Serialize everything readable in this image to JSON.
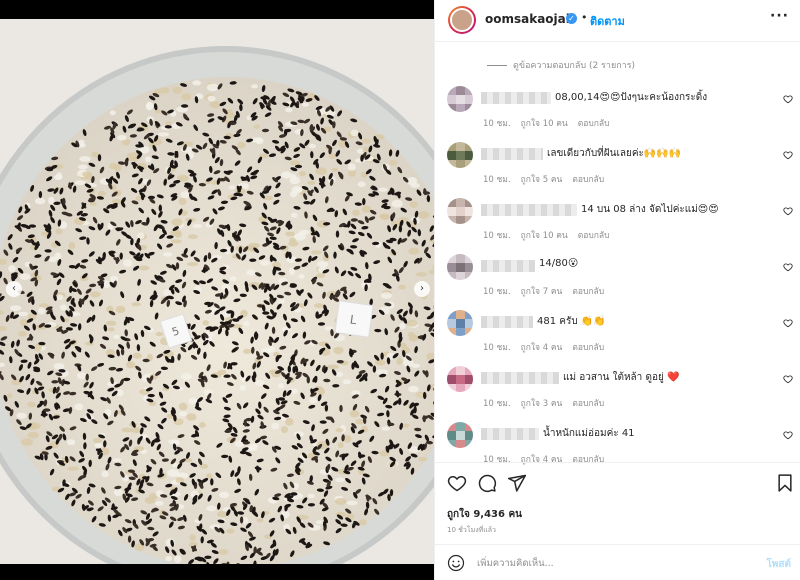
{
  "post": {
    "username": "oomsakaojai",
    "follow_label": "ติดตาม",
    "dot": "•",
    "verified_glyph": "✓",
    "more_glyph": "···"
  },
  "replies_toggle": "ดูข้อความตอบกลับ (2 รายการ)",
  "comments": [
    {
      "text": "08,00,14😍😍ปังๆนะคะน้องกระดิ้ง",
      "time": "10 ชม.",
      "likes": "ถูกใจ 10 คน",
      "reply": "ตอบกลับ"
    },
    {
      "text": "เลขเดียวกับที่ฝันเลยค่ะ🙌🙌🙌",
      "time": "10 ชม.",
      "likes": "ถูกใจ 5 คน",
      "reply": "ตอบกลับ"
    },
    {
      "text": "14 บน 08 ล่าง จัดไปค่ะแม่😍😍",
      "time": "10 ชม.",
      "likes": "ถูกใจ 10 คน",
      "reply": "ตอบกลับ"
    },
    {
      "text": "14/80😮",
      "time": "10 ชม.",
      "likes": "ถูกใจ 7 คน",
      "reply": "ตอบกลับ"
    },
    {
      "text": "481 ครับ 👏👏",
      "time": "10 ชม.",
      "likes": "ถูกใจ 4 คน",
      "reply": "ตอบกลับ"
    },
    {
      "text": "แม่ อวสาน ใต้หล้า ดูอยู่ ❤️",
      "time": "10 ชม.",
      "likes": "ถูกใจ 3 คน",
      "reply": "ตอบกลับ"
    },
    {
      "text": "น้ำหนักแม่อ่อมค่ะ 41",
      "time": "10 ชม.",
      "likes": "ถูกใจ 4 คน",
      "reply": "ตอบกลับ"
    }
  ],
  "likes_total": "ถูกใจ 9,436 คน",
  "posted_ago": "10 ชั่วโมงที่แล้ว",
  "add_comment": {
    "placeholder": "เพิ่มความคิดเห็น...",
    "post_label": "โพสต์"
  },
  "nav": {
    "left_glyph": "‹",
    "right_glyph": "›"
  },
  "colors": {
    "accent": "#0095f6",
    "heart_red": "#ed4956",
    "muted": "#8e8e8e"
  },
  "icons": [
    "heart-icon",
    "comment-icon",
    "share-icon",
    "bookmark-icon",
    "emoji-icon",
    "more-icon",
    "verified-icon"
  ]
}
